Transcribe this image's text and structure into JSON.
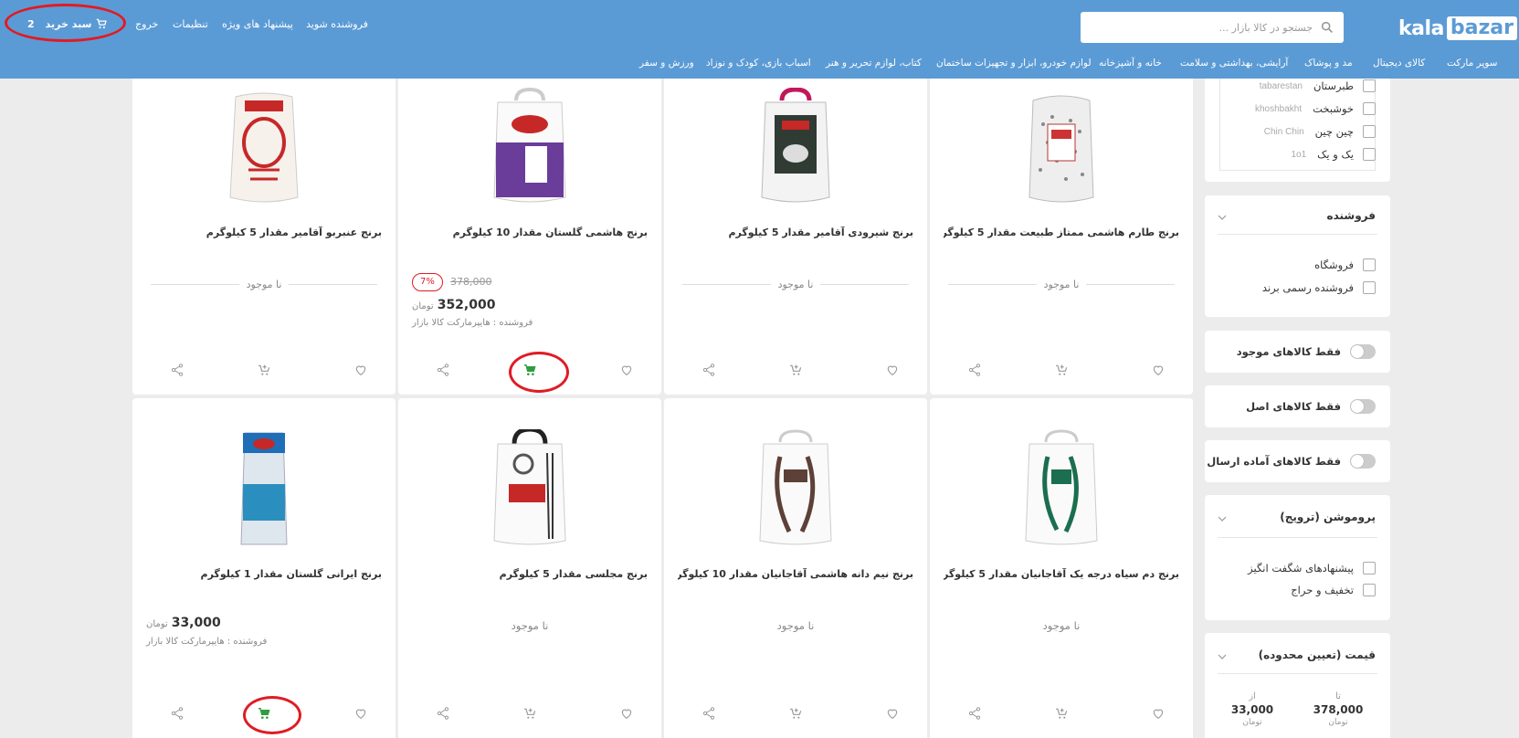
{
  "header": {
    "logo": {
      "kala": "kala",
      "bazar": "bazar"
    },
    "search_placeholder": "جستجو در کالا بازار ...",
    "nav": {
      "seller": "فروشنده شوید",
      "offers": "پیشنهاد های ویژه",
      "settings": "تنظیمات",
      "logout": "خروج",
      "cart_label": "سبد خرید",
      "cart_count": "2"
    },
    "categories": [
      "سوپر مارکت",
      "کالای دیجیتال",
      "مد و پوشاک",
      "آرایشی، بهداشتی و سلامت",
      "خانه و آشپزخانه",
      "لوازم خودرو، ابزار و تجهیزات ساختمان",
      "کتاب، لوازم تحریر و هنر",
      "اسباب بازی، کودک و نوزاد",
      "ورزش و سفر"
    ]
  },
  "sidebar": {
    "brands": [
      {
        "fa": "طبرستان",
        "en": "tabarestan"
      },
      {
        "fa": "خوشبخت",
        "en": "khoshbakht"
      },
      {
        "fa": "چین چین",
        "en": "Chin Chin"
      },
      {
        "fa": "یک و یک",
        "en": "1o1"
      }
    ],
    "seller_box": {
      "title": "فروشنده",
      "options": [
        "فروشگاه",
        "فروشنده رسمی برند"
      ]
    },
    "toggles": [
      "فقط کالاهای موجود",
      "فقط کالاهای اصل",
      "فقط کالاهای آماده ارسال"
    ],
    "promo_box": {
      "title": "پروموشن (ترویج)",
      "options": [
        "پیشنهادهای شگفت انگیز",
        "تخفیف و حراج"
      ]
    },
    "price_box": {
      "title": "قیمت (تعیین محدوده)",
      "to_label": "تا",
      "to_value": "378,000",
      "to_currency": "تومان",
      "from_label": "از",
      "from_value": "33,000",
      "from_currency": "تومان"
    }
  },
  "products": [
    {
      "title": "برنج طارم هاشمی ممتاز طبیعت مقدار 5 کیلوگرم",
      "status": "نا موجود",
      "bag": "grey"
    },
    {
      "title": "برنج شیرودی آقامیر مقدار 5 کیلوگرم",
      "status": "نا موجود",
      "bag": "dark"
    },
    {
      "title": "برنج هاشمی گلستان مقدار 10 کیلوگرم",
      "old_price": "378,000",
      "discount": "7",
      "price": "352,000",
      "currency": "تومان",
      "seller": "فروشنده : هایپرمارکت کالا بازار",
      "bag": "purple"
    },
    {
      "title": "برنج عنبربو آقامیر مقدار 5 کیلوگرم",
      "status": "نا موجود",
      "bag": "red"
    },
    {
      "title": "برنج دم سیاه درجه یک آقاجانیان مقدار 5 کیلوگرم",
      "status": "نا موجود",
      "bag": "green"
    },
    {
      "title": "برنج نیم دانه هاشمی آقاجانیان مقدار 10 کیلوگرم",
      "status": "نا موجود",
      "bag": "brown"
    },
    {
      "title": "برنج مجلسی مقدار 5 کیلوگرم",
      "status": "نا موجود",
      "bag": "black-red"
    },
    {
      "title": "برنج ایرانی گلستان مقدار 1 کیلوگرم",
      "price": "33,000",
      "currency": "تومان",
      "seller": "فروشنده : هایپرمارکت کالا بازار",
      "bag": "blue"
    }
  ],
  "colors": {
    "header": "#5b9bd5",
    "cart_green": "#2e9e3e",
    "annotation": "#e01b24"
  }
}
